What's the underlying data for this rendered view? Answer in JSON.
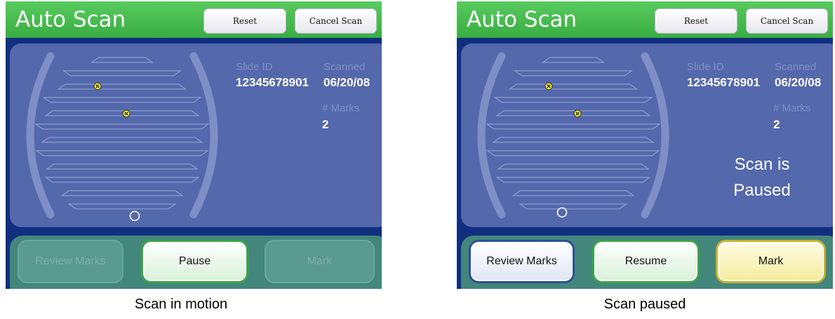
{
  "screens": [
    {
      "title": "Auto Scan",
      "reset_label": "Reset",
      "cancel_label": "Cancel Scan",
      "slide_id_label": "Slide ID",
      "slide_id": "12345678901",
      "scanned_label": "Scanned",
      "scanned_date": "06/20/08",
      "marks_label": "# Marks",
      "marks_count": "2",
      "status_line1": "",
      "status_line2": "",
      "review_label": "Review Marks",
      "review_enabled": false,
      "primary_label": "Pause",
      "mark_label": "Mark",
      "mark_enabled": false,
      "caption": "Scan in motion"
    },
    {
      "title": "Auto Scan",
      "reset_label": "Reset",
      "cancel_label": "Cancel Scan",
      "slide_id_label": "Slide ID",
      "slide_id": "12345678901",
      "scanned_label": "Scanned",
      "scanned_date": "06/20/08",
      "marks_label": "# Marks",
      "marks_count": "2",
      "status_line1": "Scan is",
      "status_line2": "Paused",
      "review_label": "Review Marks",
      "review_enabled": true,
      "primary_label": "Resume",
      "mark_label": "Mark",
      "mark_enabled": true,
      "caption": "Scan paused"
    }
  ],
  "colors": {
    "header_green": "#3fb447",
    "panel_navy": "#102f7f",
    "scan_area": "#5468ac",
    "button_bar": "#43867b",
    "mark_yellow": "#f2e826"
  },
  "icons": {
    "mark": "x-circle-icon",
    "scan_head": "circle-icon"
  }
}
